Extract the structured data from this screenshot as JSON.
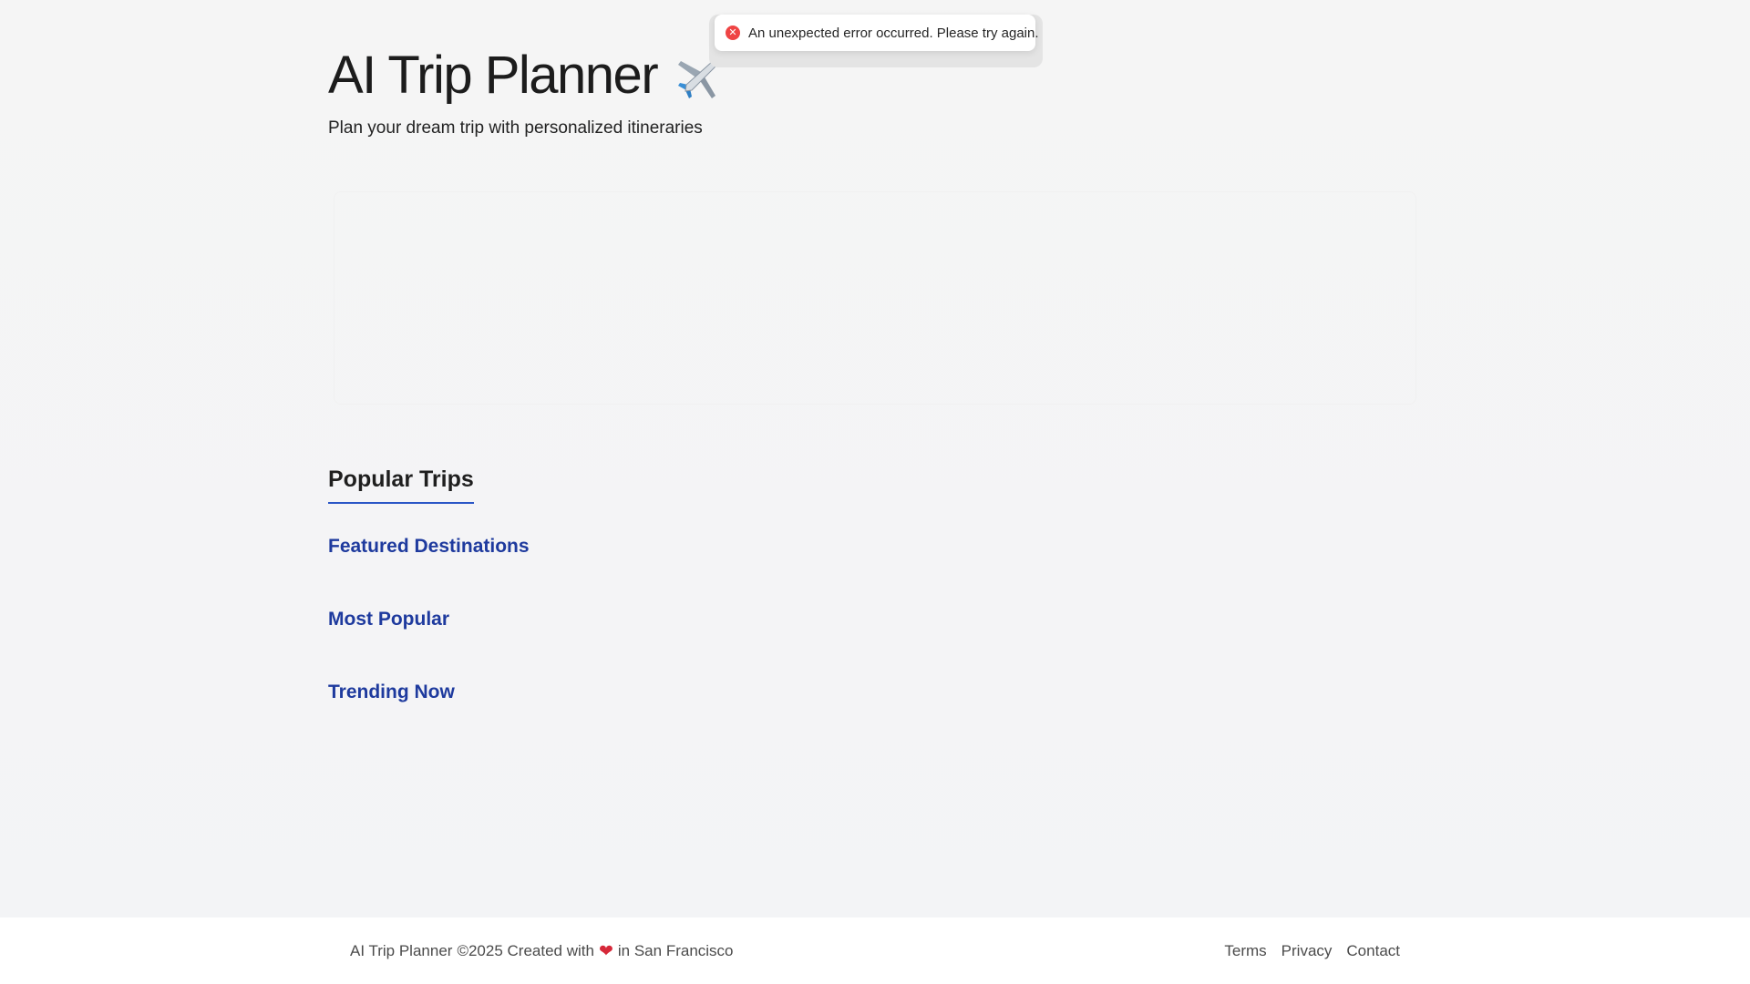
{
  "header": {
    "title": "AI Trip Planner",
    "title_icon": "airplane-icon",
    "subtitle": "Plan your dream trip with personalized itineraries"
  },
  "toast": {
    "icon": "error-icon",
    "message": "An unexpected error occurred. Please try again.",
    "color": "#ef4444"
  },
  "popular": {
    "heading": "Popular Trips",
    "accent_color": "#2a56c6",
    "link_color": "#1e3a9e",
    "categories": [
      {
        "label": "Featured Destinations"
      },
      {
        "label": "Most Popular"
      },
      {
        "label": "Trending Now"
      }
    ]
  },
  "footer": {
    "brand": "AI Trip Planner",
    "copyright": "©2025 Created with",
    "heart_icon": "heart-icon",
    "location": "in San Francisco",
    "links": [
      {
        "label": "Terms"
      },
      {
        "label": "Privacy"
      },
      {
        "label": "Contact"
      }
    ]
  }
}
